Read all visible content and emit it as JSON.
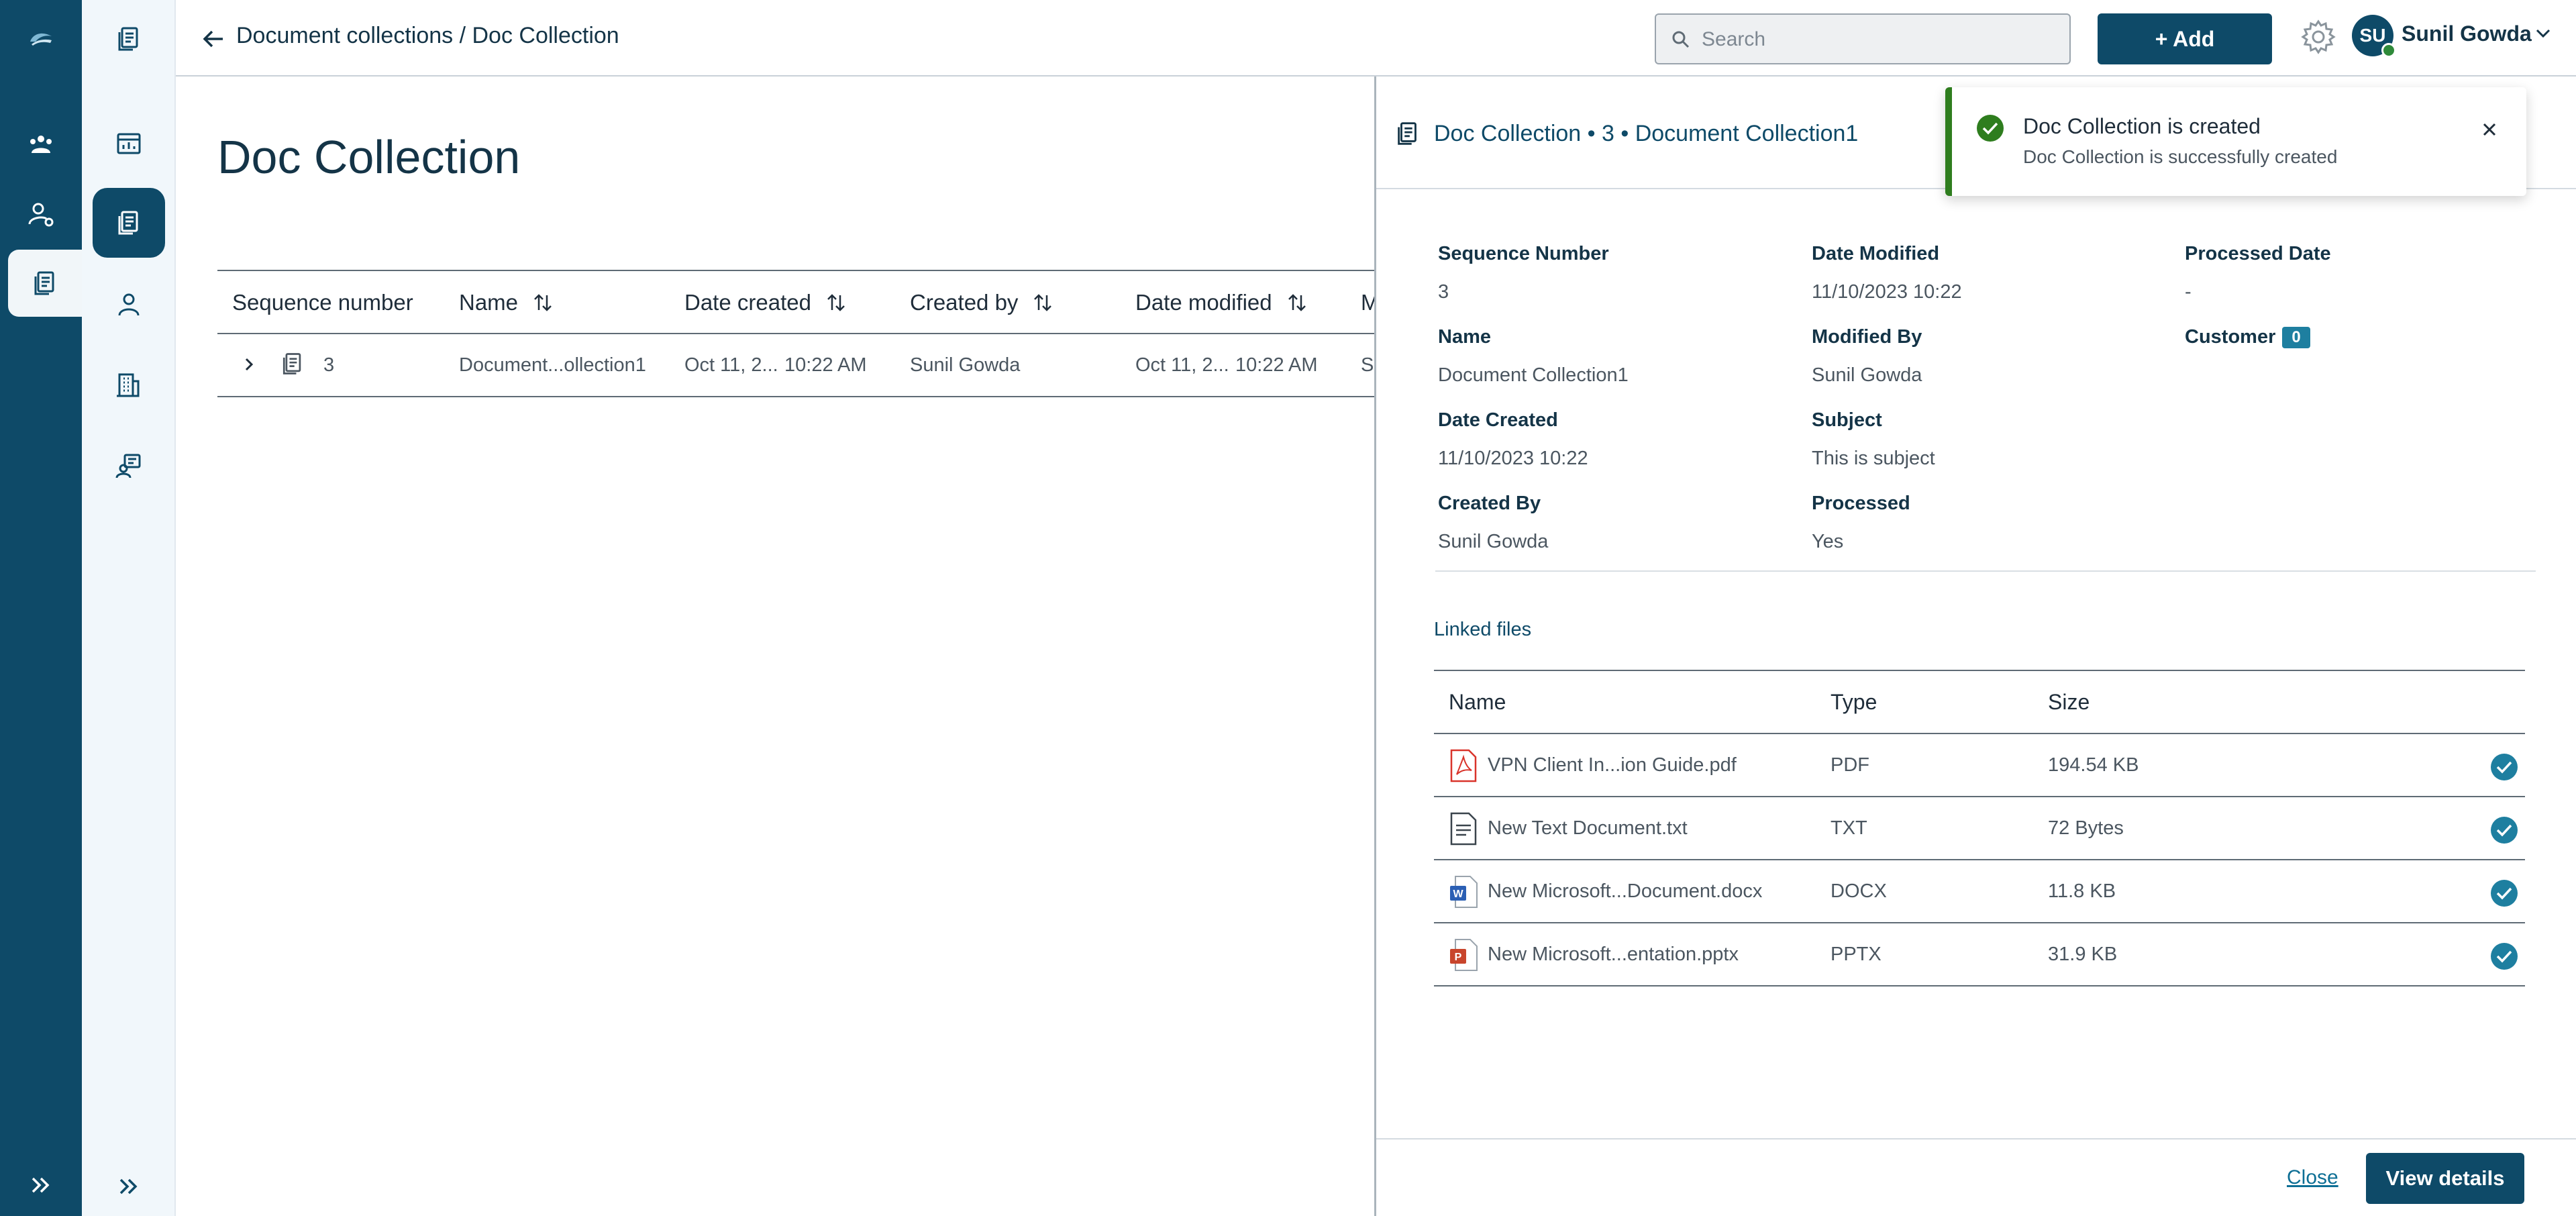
{
  "topbar": {
    "breadcrumb": "Document collections / Doc Collection",
    "search_placeholder": "Search",
    "add_label": "+ Add",
    "avatar_initials": "SU",
    "user_name": "Sunil Gowda"
  },
  "page": {
    "title": "Doc Collection"
  },
  "table": {
    "headers": [
      "Sequence number",
      "Name",
      "Date created",
      "Created by",
      "Date modified",
      "M"
    ],
    "rows": [
      {
        "sequence": "3",
        "name": "Document...ollection1",
        "date_created_date": "Oct 11, 2...",
        "date_created_time": "10:22 AM",
        "created_by": "Sunil  Gowda",
        "date_modified_date": "Oct 11, 2...",
        "date_modified_time": "10:22 AM",
        "modified_by": "Su"
      }
    ]
  },
  "drawer": {
    "title": "Doc Collection • 3 • Document Collection1",
    "fields": {
      "sequence_number": {
        "label": "Sequence Number",
        "value": "3"
      },
      "date_modified": {
        "label": "Date Modified",
        "value": "11/10/2023 10:22"
      },
      "processed_date": {
        "label": "Processed Date",
        "value": "-"
      },
      "name": {
        "label": "Name",
        "value": "Document Collection1"
      },
      "modified_by": {
        "label": "Modified By",
        "value": "Sunil  Gowda"
      },
      "customer": {
        "label": "Customer",
        "badge": "0"
      },
      "date_created": {
        "label": "Date Created",
        "value": "11/10/2023 10:22"
      },
      "subject": {
        "label": "Subject",
        "value": "This is subject"
      },
      "created_by": {
        "label": "Created By",
        "value": "Sunil  Gowda"
      },
      "processed": {
        "label": "Processed",
        "value": "Yes"
      }
    },
    "linked_files_title": "Linked files",
    "linked_headers": [
      "Name",
      "Type",
      "Size"
    ],
    "linked_files": [
      {
        "name": "VPN Client In...ion Guide.pdf",
        "type": "PDF",
        "size": "194.54 KB",
        "icon": "pdf-file-icon"
      },
      {
        "name": "New Text Document.txt",
        "type": "TXT",
        "size": "72 Bytes",
        "icon": "text-file-icon"
      },
      {
        "name": "New Microsoft...Document.docx",
        "type": "DOCX",
        "size": "11.8 KB",
        "icon": "word-file-icon"
      },
      {
        "name": "New Microsoft...entation.pptx",
        "type": "PPTX",
        "size": "31.9 KB",
        "icon": "powerpoint-file-icon"
      }
    ],
    "close_label": "Close",
    "view_details_label": "View details"
  },
  "toast": {
    "title": "Doc Collection is created",
    "message": "Doc Collection is successfully created"
  },
  "colors": {
    "brand": "#0e4a68",
    "accent": "#1e7fa0",
    "success": "#2e7d1e"
  }
}
